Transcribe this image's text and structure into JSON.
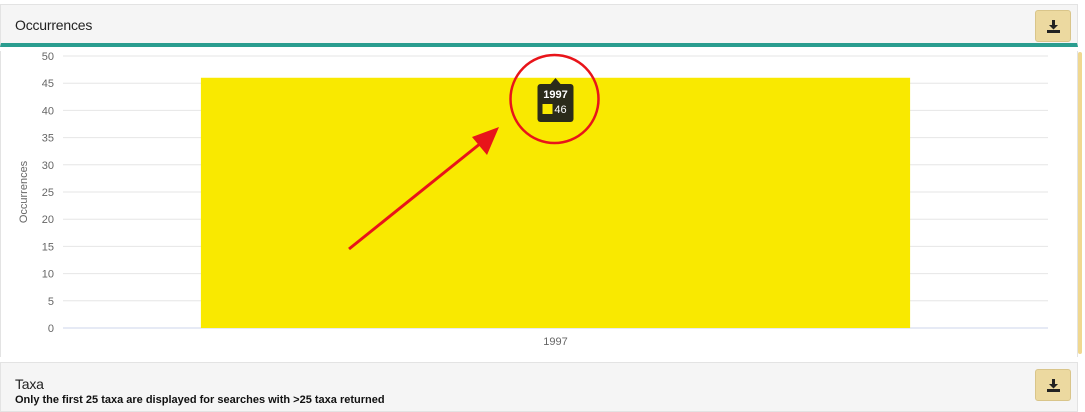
{
  "panels": {
    "occurrences": {
      "title": "Occurrences",
      "download_icon": "download-icon"
    },
    "taxa": {
      "title": "Taxa",
      "note": "Only the first 25 taxa are displayed for searches with >25 taxa returned",
      "download_icon": "download-icon"
    }
  },
  "colors": {
    "bar": "#f9e900",
    "header_accent": "#2a9d8f",
    "button_bg": "#ecd9a0",
    "annotation": "#e8141a",
    "tooltip_bg": "#2b2b1a"
  },
  "tooltip": {
    "title": "1997",
    "value": "46"
  },
  "chart_data": {
    "type": "bar",
    "categories": [
      "1997"
    ],
    "values": [
      46
    ],
    "title": "",
    "xlabel": "",
    "ylabel": "Occurrences",
    "ylim": [
      0,
      50
    ],
    "yticks": [
      0,
      5,
      10,
      15,
      20,
      25,
      30,
      35,
      40,
      45,
      50
    ],
    "grid": true,
    "legend": "none"
  }
}
